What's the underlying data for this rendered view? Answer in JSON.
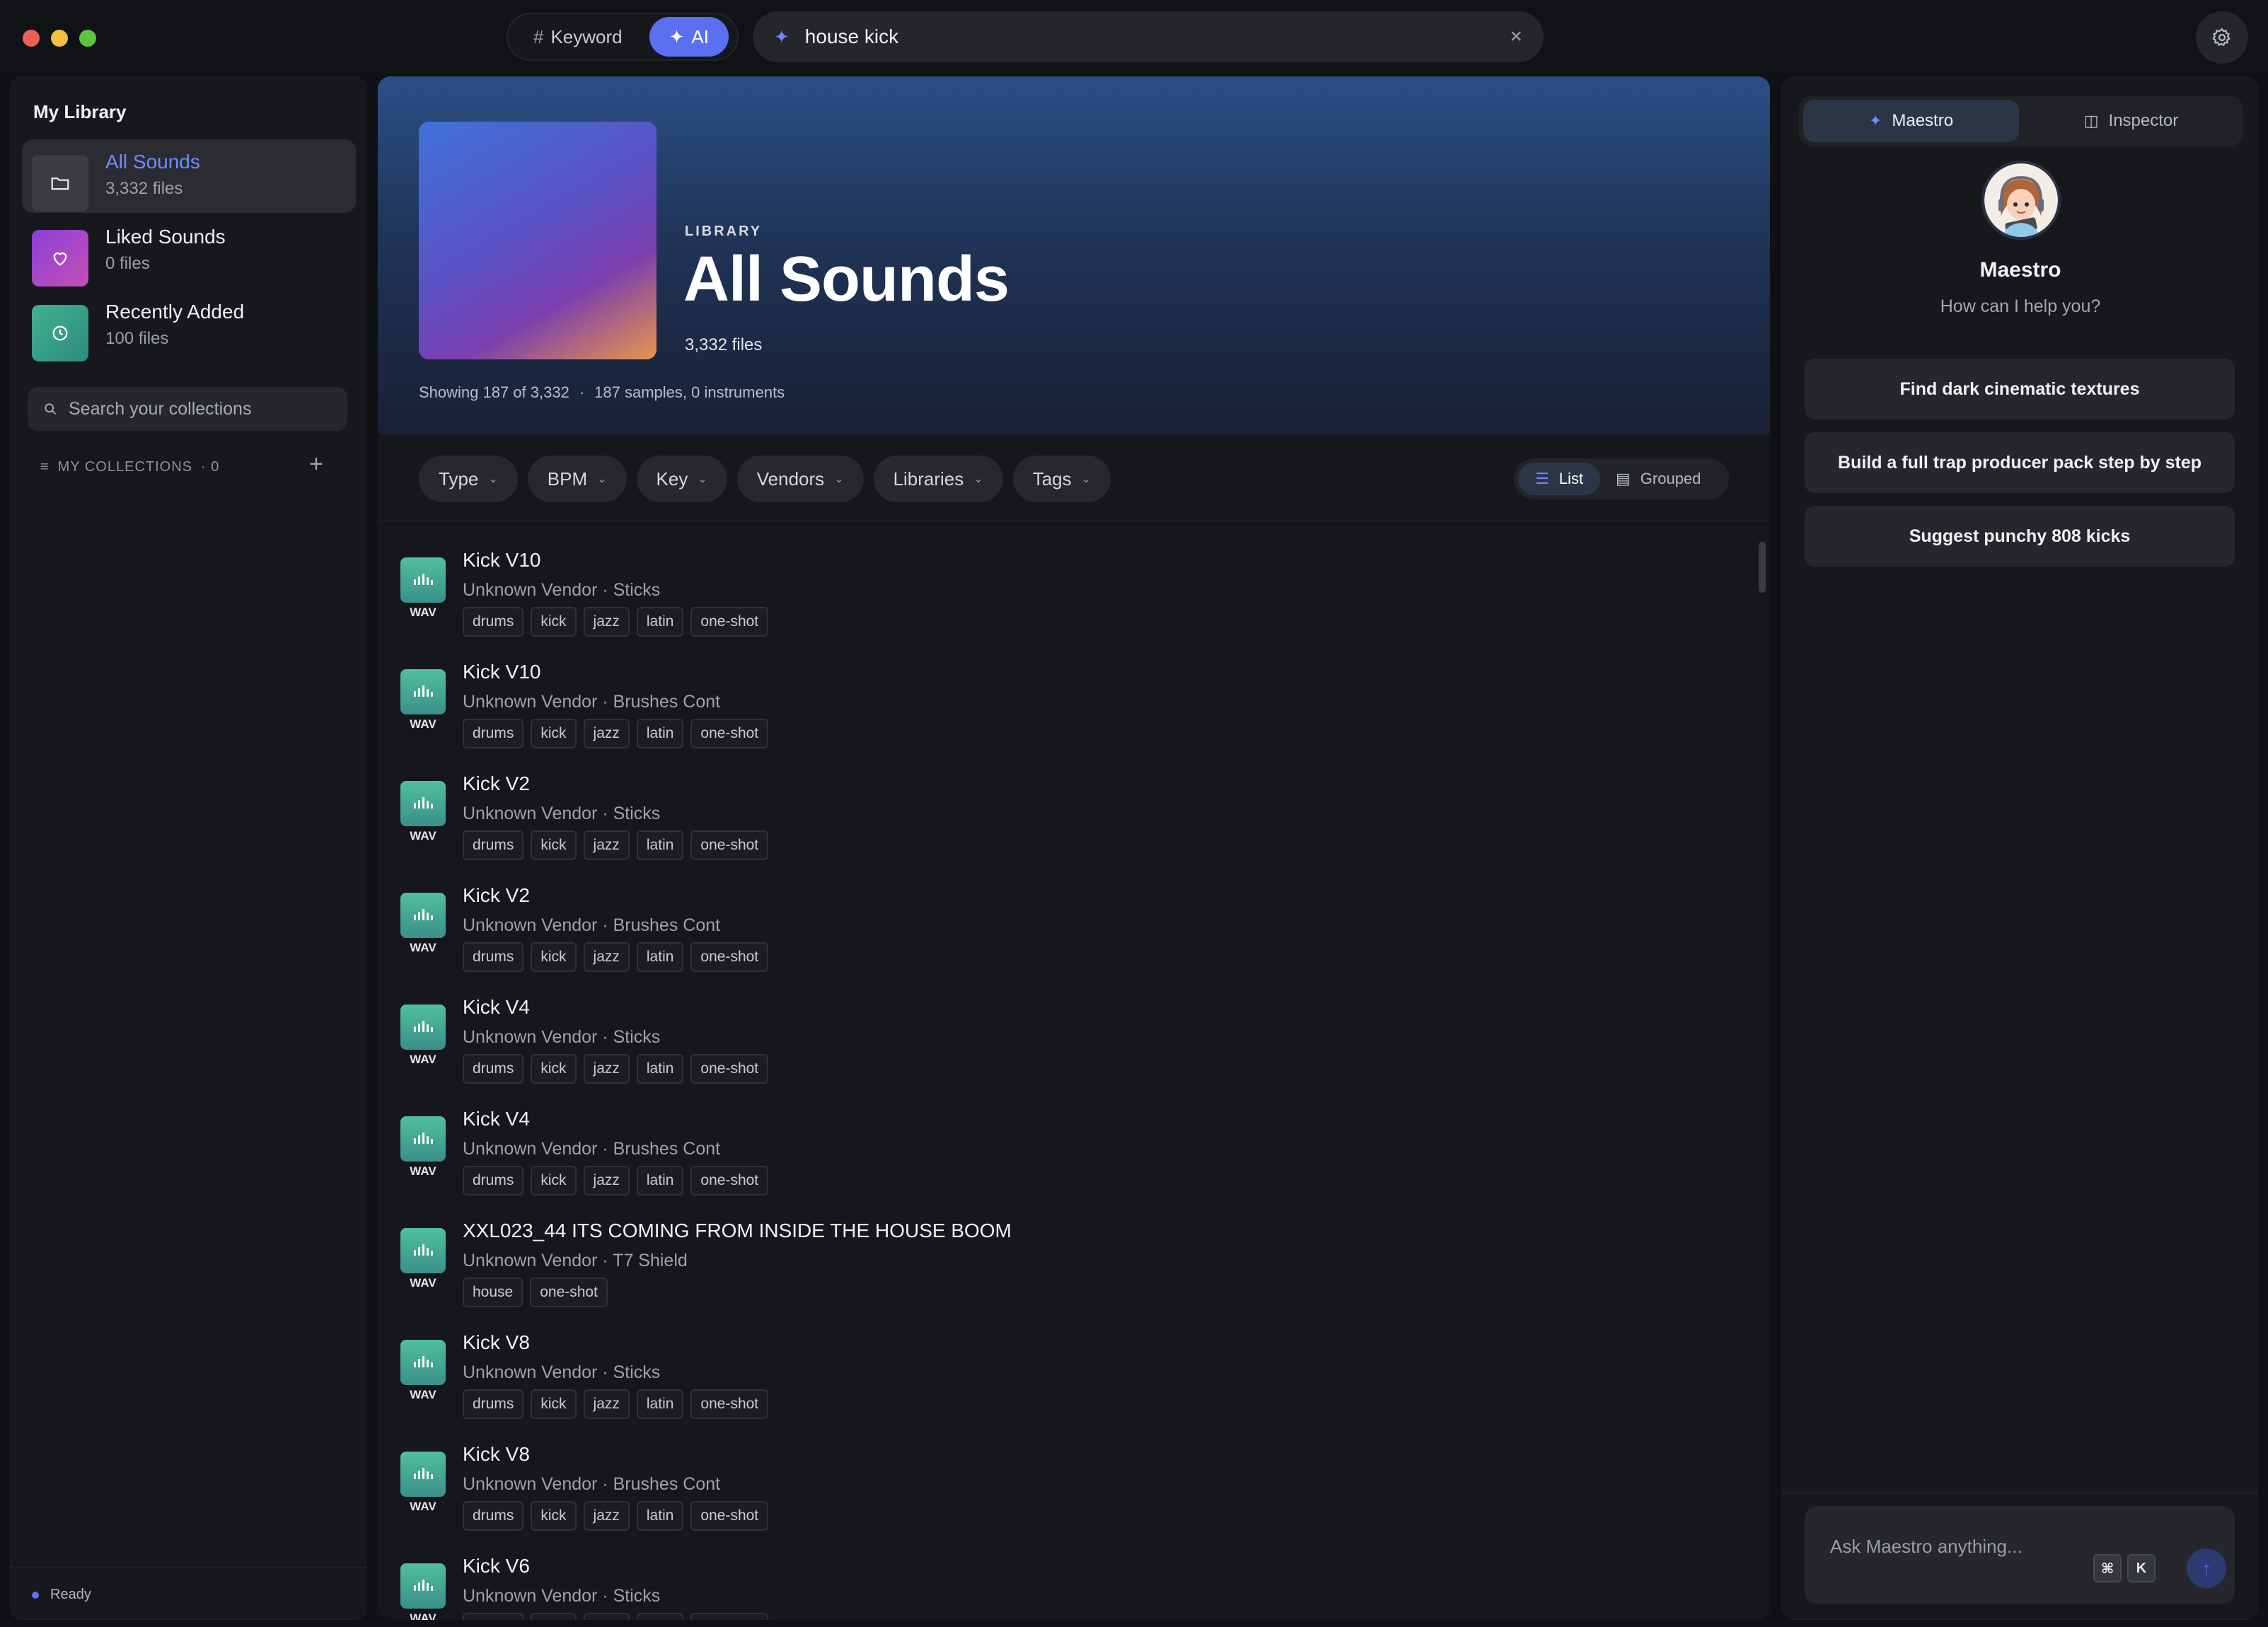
{
  "titlebar": {
    "mode_keyword": "Keyword",
    "mode_ai": "AI",
    "search_value": "house kick",
    "clear_glyph": "×"
  },
  "sidebar": {
    "title": "My Library",
    "items": [
      {
        "name": "All Sounds",
        "count": "3,332 files",
        "icon": "folder-icon",
        "color": "#3a3c42"
      },
      {
        "name": "Liked Sounds",
        "count": "0 files",
        "icon": "heart-icon",
        "color": "#a23fd0"
      },
      {
        "name": "Recently Added",
        "count": "100 files",
        "icon": "clock-icon",
        "color": "#3aa38a"
      }
    ],
    "search_placeholder": "Search your collections",
    "collections_label": "MY COLLECTIONS",
    "collections_count": "· 0",
    "add_glyph": "+",
    "status": "Ready"
  },
  "hero": {
    "eyebrow": "LIBRARY",
    "title": "All Sounds",
    "file_count": "3,332 files",
    "showing": "Showing 187 of 3,332",
    "separator": "·",
    "breakdown": "187 samples, 0 instruments"
  },
  "filters": [
    "Type",
    "BPM",
    "Key",
    "Vendors",
    "Libraries",
    "Tags"
  ],
  "view_toggle": {
    "list": "List",
    "grouped": "Grouped"
  },
  "sounds": [
    {
      "title": "Kick V10",
      "subtitle": "Unknown Vendor · Sticks",
      "format": "WAV",
      "tags": [
        "drums",
        "kick",
        "jazz",
        "latin",
        "one-shot"
      ]
    },
    {
      "title": "Kick V10",
      "subtitle": "Unknown Vendor · Brushes Cont",
      "format": "WAV",
      "tags": [
        "drums",
        "kick",
        "jazz",
        "latin",
        "one-shot"
      ]
    },
    {
      "title": "Kick V2",
      "subtitle": "Unknown Vendor · Sticks",
      "format": "WAV",
      "tags": [
        "drums",
        "kick",
        "jazz",
        "latin",
        "one-shot"
      ]
    },
    {
      "title": "Kick V2",
      "subtitle": "Unknown Vendor · Brushes Cont",
      "format": "WAV",
      "tags": [
        "drums",
        "kick",
        "jazz",
        "latin",
        "one-shot"
      ]
    },
    {
      "title": "Kick V4",
      "subtitle": "Unknown Vendor · Sticks",
      "format": "WAV",
      "tags": [
        "drums",
        "kick",
        "jazz",
        "latin",
        "one-shot"
      ]
    },
    {
      "title": "Kick V4",
      "subtitle": "Unknown Vendor · Brushes Cont",
      "format": "WAV",
      "tags": [
        "drums",
        "kick",
        "jazz",
        "latin",
        "one-shot"
      ]
    },
    {
      "title": "XXL023_44 ITS COMING FROM INSIDE THE HOUSE BOOM",
      "subtitle": "Unknown Vendor · T7 Shield",
      "format": "WAV",
      "tags": [
        "house",
        "one-shot"
      ]
    },
    {
      "title": "Kick V8",
      "subtitle": "Unknown Vendor · Sticks",
      "format": "WAV",
      "tags": [
        "drums",
        "kick",
        "jazz",
        "latin",
        "one-shot"
      ]
    },
    {
      "title": "Kick V8",
      "subtitle": "Unknown Vendor · Brushes Cont",
      "format": "WAV",
      "tags": [
        "drums",
        "kick",
        "jazz",
        "latin",
        "one-shot"
      ]
    },
    {
      "title": "Kick V6",
      "subtitle": "Unknown Vendor · Sticks",
      "format": "WAV",
      "tags": [
        "drums",
        "kick",
        "jazz",
        "latin",
        "one-shot"
      ]
    }
  ],
  "right_panel": {
    "tab_maestro": "Maestro",
    "tab_inspector": "Inspector",
    "name": "Maestro",
    "help": "How can I help you?",
    "suggestions": [
      "Find dark cinematic textures",
      "Build a full trap producer pack step by step",
      "Suggest punchy 808 kicks"
    ],
    "ask_placeholder": "Ask Maestro anything...",
    "shortcut_mod": "⌘",
    "shortcut_key": "K"
  }
}
